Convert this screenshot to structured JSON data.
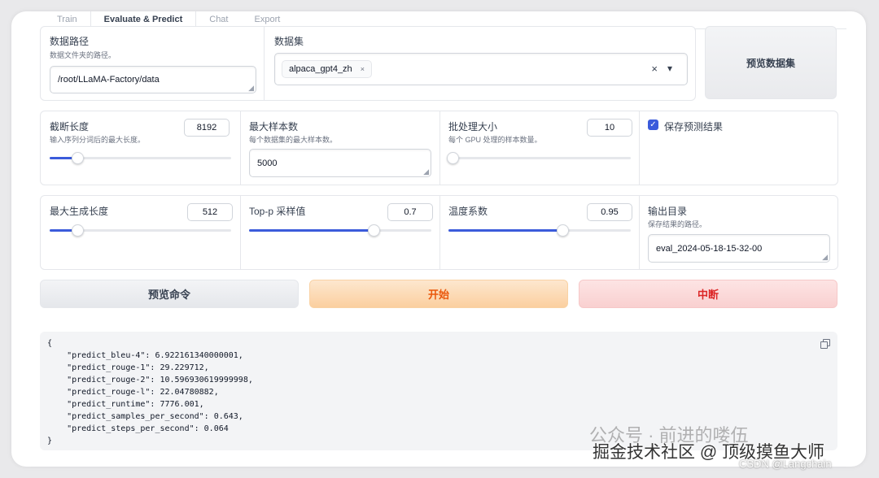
{
  "tabs": [
    "Train",
    "Evaluate & Predict",
    "Chat",
    "Export"
  ],
  "dataset_dir": {
    "label": "数据路径",
    "info": "数据文件夹的路径。",
    "value": "/root/LLaMA-Factory/data"
  },
  "dataset": {
    "label": "数据集",
    "selected": "alpaca_gpt4_zh",
    "chip_close": "×",
    "clear": "×",
    "dropdown": "▾"
  },
  "preview_dataset_button": "预览数据集",
  "cutoff_len": {
    "label": "截断长度",
    "info": "输入序列分词后的最大长度。",
    "value": "8192",
    "fraction": 0.15
  },
  "max_samples": {
    "label": "最大样本数",
    "info": "每个数据集的最大样本数。",
    "value": "5000"
  },
  "batch_size": {
    "label": "批处理大小",
    "info": "每个 GPU 处理的样本数量。",
    "value": "10",
    "fraction": 0.02
  },
  "predict_results": {
    "label": "保存预测结果",
    "checked": true
  },
  "max_new_tokens": {
    "label": "最大生成长度",
    "value": "512",
    "fraction": 0.15
  },
  "top_p": {
    "label": "Top-p 采样值",
    "value": "0.7",
    "fraction": 0.68
  },
  "temperature": {
    "label": "温度系数",
    "value": "0.95",
    "fraction": 0.62
  },
  "output_dir": {
    "label": "输出目录",
    "info": "保存结果的路径。",
    "value": "eval_2024-05-18-15-32-00"
  },
  "buttons": {
    "preview_command": "预览命令",
    "start": "开始",
    "abort": "中断"
  },
  "colors": {
    "accent": "#3b5bdb",
    "start_text": "#ea580c",
    "abort_text": "#dc2626"
  },
  "output_lines": [
    "{",
    "    \"predict_bleu-4\": 6.922161340000001,",
    "    \"predict_rouge-1\": 29.229712,",
    "    \"predict_rouge-2\": 10.596930619999998,",
    "    \"predict_rouge-l\": 22.04780882,",
    "    \"predict_runtime\": 7776.001,",
    "    \"predict_samples_per_second\": 0.643,",
    "    \"predict_steps_per_second\": 0.064",
    "}"
  ],
  "copy_icon": "copy-icon",
  "watermarks": {
    "wechat": "公众号 · 前进的喽伍",
    "juejin": "掘金技术社区 @ 顶级摸鱼大师",
    "csdn": "CSDN @Langchain"
  }
}
